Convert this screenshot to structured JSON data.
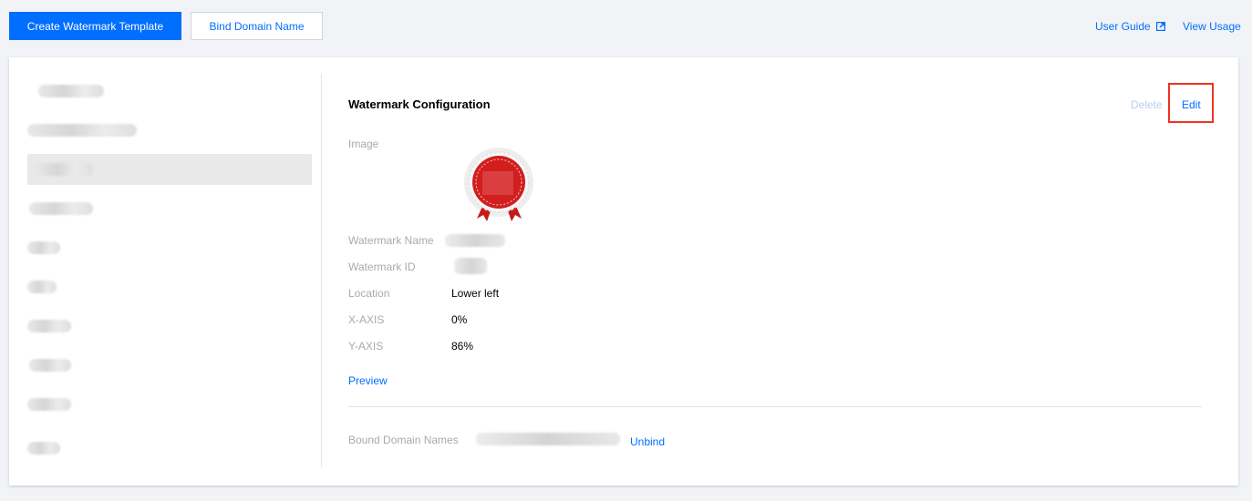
{
  "toolbar": {
    "create_label": "Create Watermark Template",
    "bind_label": "Bind Domain Name",
    "user_guide": "User Guide",
    "view_usage": "View Usage"
  },
  "detail": {
    "title": "Watermark Configuration",
    "delete_label": "Delete",
    "edit_label": "Edit",
    "image_label": "Image",
    "name_label": "Watermark Name",
    "id_label": "Watermark ID",
    "location_label": "Location",
    "location_value": "Lower left",
    "x_label": "X-AXIS",
    "x_value": "0%",
    "y_label": "Y-AXIS",
    "y_value": "86%",
    "preview_label": "Preview",
    "bound_label": "Bound Domain Names",
    "unbind_label": "Unbind"
  },
  "colors": {
    "primary": "#006eff",
    "highlight": "#ee3322",
    "seal_red": "#d21e1e"
  },
  "icons": {
    "external_link": "external-link-icon",
    "seal": "seal-badge-icon"
  }
}
